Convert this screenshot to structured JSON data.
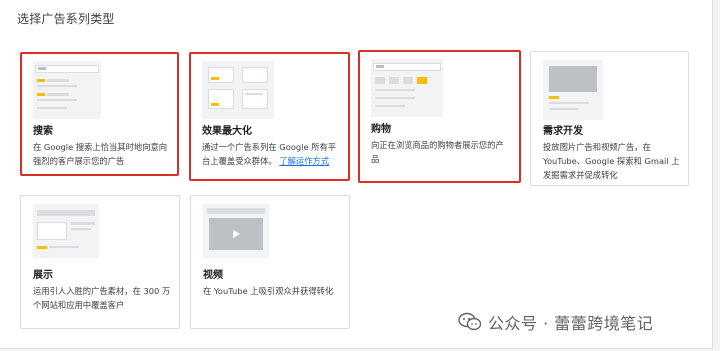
{
  "section_title": "选择广告系列类型",
  "cards": [
    {
      "title": "搜索",
      "desc_lines": [
        "在 Google 搜索上恰当其时地向意向",
        "强烈的客户展示您的广告"
      ]
    },
    {
      "title": "效果最大化",
      "desc_lines": [
        "通过一个广告系列在 Google 所有平",
        "台上覆盖受众群体。"
      ],
      "link": "了解运作方式"
    },
    {
      "title": "购物",
      "desc_lines": [
        "向正在浏览商品的购物者展示您的产",
        "品"
      ]
    },
    {
      "title": "需求开发",
      "desc_lines": [
        "投放图片广告和视频广告，在",
        "YouTube、Google 探索和 Gmail 上",
        "发掘需求并促成转化"
      ]
    },
    {
      "title": "展示",
      "desc_lines": [
        "运用引人入胜的广告素材，在 300 万",
        "个网站和应用中覆盖客户"
      ]
    },
    {
      "title": "视频",
      "desc_lines": [
        "在 YouTube 上吸引观众并获得转化"
      ]
    }
  ],
  "watermark": "公众号 · 蕾蕾跨境笔记",
  "colors": {
    "highlight": "#d93025",
    "accent": "#fbbc04",
    "link": "#1a73e8"
  }
}
